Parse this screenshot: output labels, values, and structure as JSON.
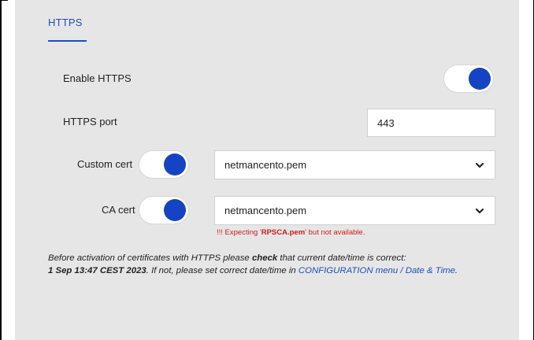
{
  "tab": {
    "label": "HTTPS"
  },
  "enable_https": {
    "label": "Enable HTTPS",
    "state": "on"
  },
  "https_port": {
    "label": "HTTPS port",
    "value": "443"
  },
  "custom_cert": {
    "label": "Custom cert",
    "state": "on",
    "selected": "netmancento.pem"
  },
  "ca_cert": {
    "label": "CA cert",
    "state": "on",
    "selected": "netmancento.pem",
    "warning_prefix": "!!! Expecting '",
    "warning_file": "RPSCA.pem",
    "warning_suffix": "' but not available."
  },
  "note": {
    "part1": "Before activation of certificates with HTTPS please ",
    "check": "check",
    "part2": " that current date/time is correct: ",
    "datetime": "1 Sep 13:47 CEST 2023",
    "part3": ". If not, please set correct date/time in ",
    "link": "CONFIGURATION menu / Date & Time",
    "part4": "."
  },
  "colors": {
    "accent": "#1444c4",
    "link": "#1a4fc1",
    "warning": "#d21a1a",
    "panel": "#e6e6e6"
  },
  "icons": {
    "select_arrow": "chevron-down-icon"
  }
}
